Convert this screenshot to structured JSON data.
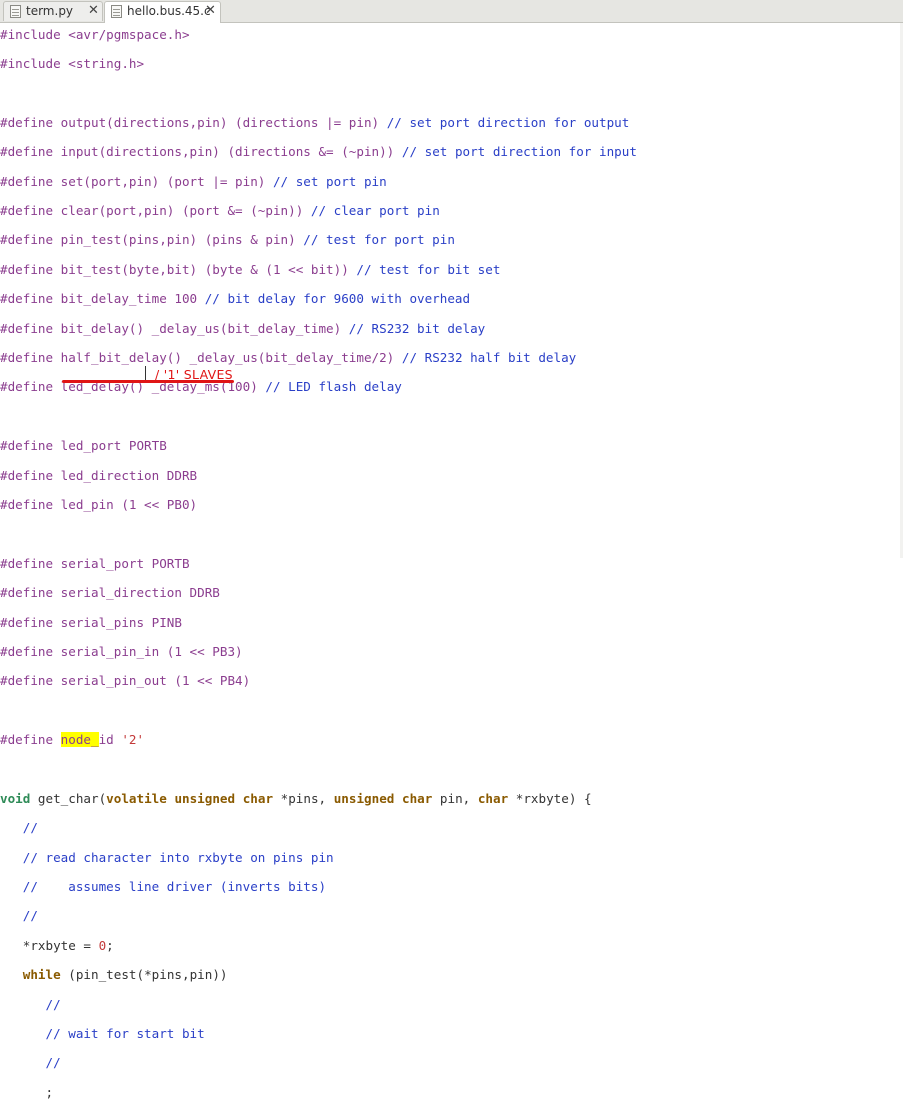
{
  "tabs": [
    {
      "label": "term.py",
      "close": "✕"
    },
    {
      "label": "hello.bus.45.c",
      "close": "✕"
    }
  ],
  "code": {
    "l0": "#include <avr/pgmspace.h>",
    "l1": "#include <string.h>",
    "d_output": "#define output(directions,pin) (directions |= pin)",
    "c_output": " // set port direction for output",
    "d_input": "#define input(directions,pin) (directions &= (~pin))",
    "c_input": " // set port direction for input",
    "d_set": "#define set(port,pin) (port |= pin)",
    "c_set": " // set port pin",
    "d_clear": "#define clear(port,pin) (port &= (~pin))",
    "c_clear": " // clear port pin",
    "d_pintest": "#define pin_test(pins,pin) (pins & pin)",
    "c_pintest": " // test for port pin",
    "d_bittest": "#define bit_test(byte,bit) (byte & (1 << bit))",
    "c_bittest": " // test for bit set",
    "d_bdt": "#define bit_delay_time 100",
    "c_bdt": " // bit delay for 9600 with overhead",
    "d_bd": "#define bit_delay() _delay_us(bit_delay_time)",
    "c_bd": " // RS232 bit delay",
    "d_hbd": "#define half_bit_delay() _delay_us(bit_delay_time/2)",
    "c_hbd": " // RS232 half bit delay",
    "d_led": "#define led_delay() _delay_ms(100)",
    "c_led": " // LED flash delay",
    "led_port": "#define led_port PORTB",
    "led_dir": "#define led_direction DDRB",
    "led_pin": "#define led_pin (1 << PB0)",
    "s_port": "#define serial_port PORTB",
    "s_dir": "#define serial_direction DDRB",
    "s_pins": "#define serial_pins PINB",
    "s_in": "#define serial_pin_in (1 << PB3)",
    "s_out": "#define serial_pin_out (1 << PB4)",
    "node_pre": "#define ",
    "node_hl": "node_",
    "node_rest": "id ",
    "node_val": "'2'",
    "f_void": "void",
    "f_name": " get_char(",
    "f_vol": "volatile",
    "f_uns1": "unsigned",
    "f_char1": "char",
    "f_a1": " *pins, ",
    "f_uns2": "unsigned",
    "f_char2": "char",
    "f_a2": " pin, ",
    "f_char3": "char",
    "f_a3": " *rxbyte) {",
    "b1": "   //",
    "b2": "   // read character into rxbyte on pins pin",
    "b3": "   //    assumes line driver (inverts bits)",
    "b4": "   //",
    "b5a": "   *rxbyte = ",
    "b5n": "0",
    "b5b": ";",
    "b6a": "   ",
    "b6w": "while",
    "b6b": " (pin_test(*pins,pin))",
    "b7": "      //",
    "b8": "      // wait for start bit",
    "b9": "      //",
    "b10": "      ;"
  },
  "annotation": "/ '1' SLAVES",
  "colors": {
    "annotation": "#e01515",
    "highlight": "#ffff00",
    "comment": "#2a3fc7",
    "preproc": "#8b3d8f"
  }
}
